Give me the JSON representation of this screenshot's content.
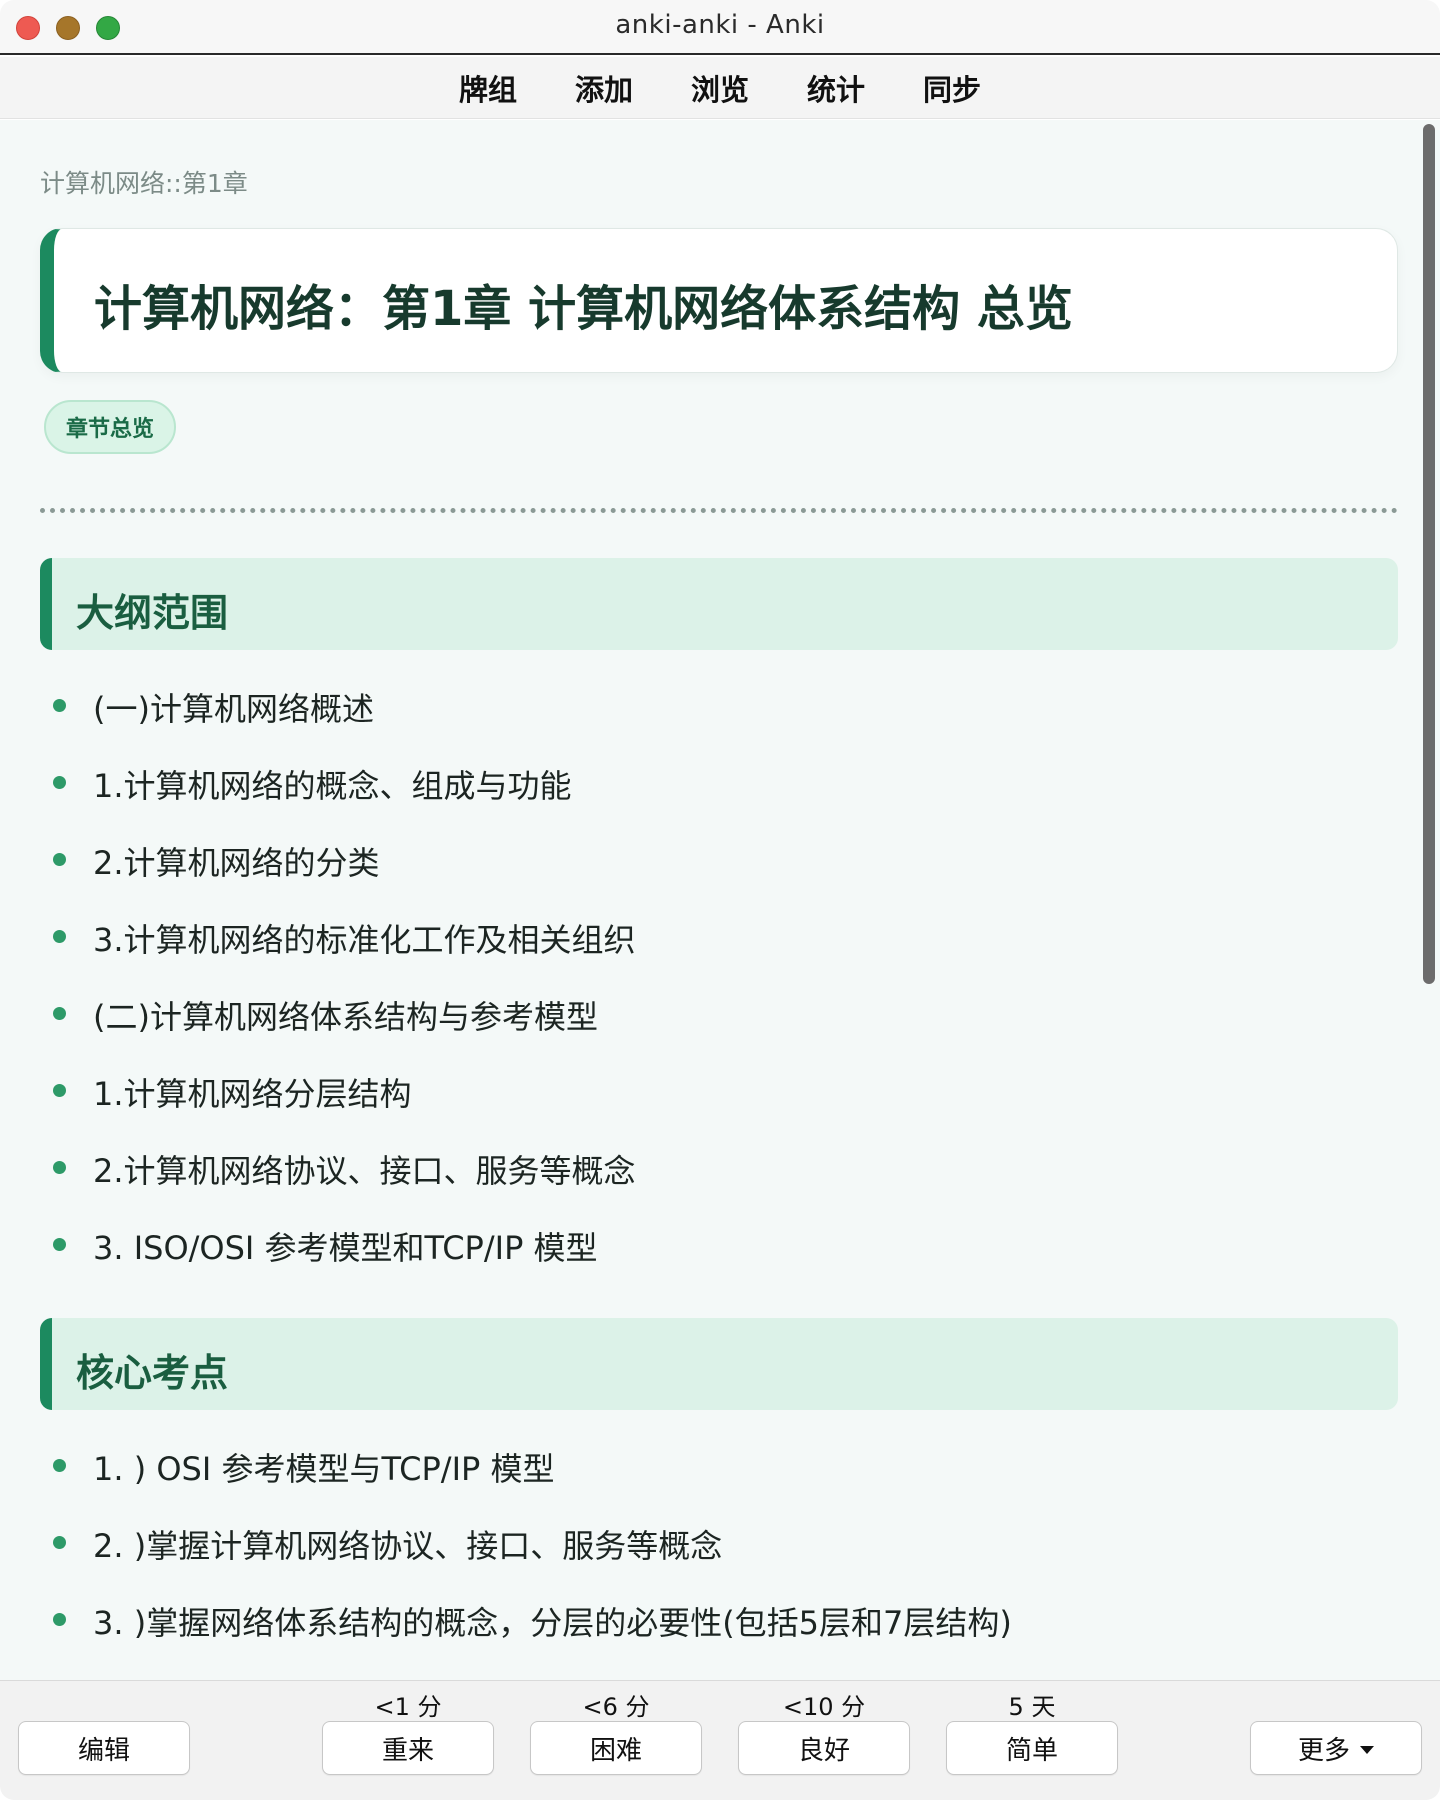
{
  "window": {
    "title": "anki-anki - Anki"
  },
  "topnav": {
    "items": [
      "牌组",
      "添加",
      "浏览",
      "统计",
      "同步"
    ]
  },
  "card": {
    "breadcrumb": "计算机网络::第1章",
    "title": "计算机网络：第1章 计算机网络体系结构 总览",
    "tag": "章节总览",
    "sections": [
      {
        "title": "大纲范围",
        "items": [
          "(一)计算机网络概述",
          "1.计算机网络的概念、组成与功能",
          "2.计算机网络的分类",
          "3.计算机网络的标准化工作及相关组织",
          "(二)计算机网络体系结构与参考模型",
          "1.计算机网络分层结构",
          "2.计算机网络协议、接口、服务等概念",
          "3. ISO/OSI 参考模型和TCP/IP 模型"
        ]
      },
      {
        "title": "核心考点",
        "items": [
          "1. ) OSI 参考模型与TCP/IP 模型",
          "2. )掌握计算机网络协议、接口、服务等概念",
          "3. )掌握网络体系结构的概念，分层的必要性(包括5层和7层结构)"
        ]
      }
    ]
  },
  "bottombar": {
    "edit_label": "编辑",
    "more_label": "更多",
    "answers": [
      {
        "label": "重来",
        "interval": "<1 分"
      },
      {
        "label": "困难",
        "interval": "<6 分"
      },
      {
        "label": "良好",
        "interval": "<10 分"
      },
      {
        "label": "简单",
        "interval": "5 天"
      }
    ]
  }
}
